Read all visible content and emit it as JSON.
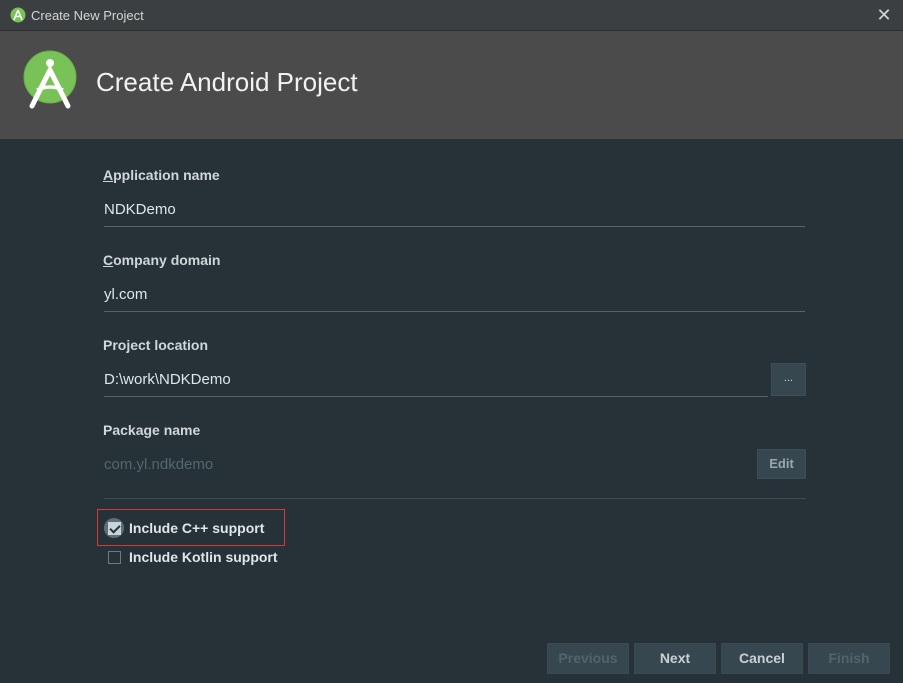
{
  "window": {
    "title": "Create New Project",
    "close_icon": "close-icon",
    "close_glyph": "✕"
  },
  "header": {
    "title": "Create Android Project",
    "logo_icon": "android-studio-logo-icon"
  },
  "form": {
    "application_name": {
      "label_accel": "A",
      "label_rest": "pplication name",
      "value": "NDKDemo"
    },
    "company_domain": {
      "label_accel": "C",
      "label_rest": "ompany domain",
      "value": "yl.com"
    },
    "project_location": {
      "label": "Project location",
      "value": "D:\\work\\NDKDemo",
      "browse_label": "..."
    },
    "package_name": {
      "label": "Package name",
      "value": "com.yl.ndkdemo",
      "edit_label": "Edit"
    }
  },
  "options": [
    {
      "label": "Include C++ support",
      "checked": true
    },
    {
      "label": "Include Kotlin support",
      "checked": false
    }
  ],
  "buttons": {
    "previous": "Previous",
    "next": "Next",
    "cancel": "Cancel",
    "finish": "Finish"
  },
  "colors": {
    "background": "#263238",
    "header": "#4b4b4b",
    "android_green": "#78c257",
    "highlight_border": "#d23a3a"
  }
}
